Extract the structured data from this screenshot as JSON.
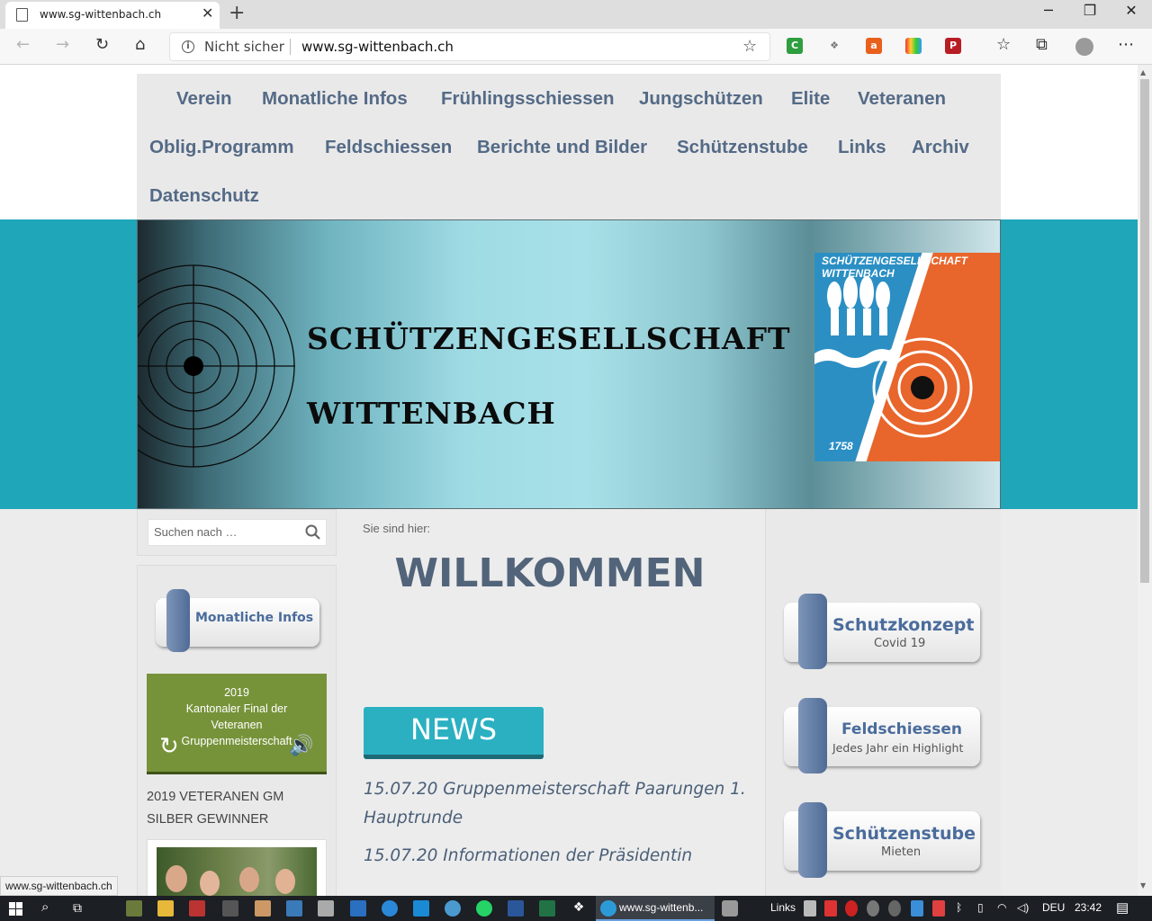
{
  "browser": {
    "tab_title": "www.sg-wittenbach.ch",
    "new_tab": "+",
    "security_label": "Nicht sicher",
    "url": "www.sg-wittenbach.ch",
    "icons": [
      "back-icon",
      "forward-icon",
      "refresh-icon",
      "home-icon",
      "info-icon",
      "favorite-star-icon",
      "favorites-icon",
      "collections-icon",
      "profile-icon",
      "more-icon"
    ]
  },
  "nav": {
    "row1": [
      "Verein",
      "Monatliche Infos",
      "Frühlingsschiessen",
      "Jungschützen",
      "Elite",
      "Veteranen"
    ],
    "row2": [
      "Oblig.Programm",
      "Feldschiessen",
      "Berichte und Bilder",
      "Schützenstube",
      "Links",
      "Archiv"
    ],
    "row3": [
      "Datenschutz"
    ]
  },
  "banner": {
    "line1": "SCHÜTZENGESELLSCHAFT",
    "line2": "WITTENBACH",
    "flag_caption": "SCHÜTZENGESELLSCHAFT WITTENBACH",
    "flag_year": "1758"
  },
  "sidebar": {
    "search_placeholder": "Suchen nach …",
    "monthly_button": "Monatliche Infos",
    "video_text": [
      "2019",
      "Kantonaler Final der",
      "Veteranen",
      "Gruppenmeisterschaft"
    ],
    "veteran_text": [
      "2019 VETERANEN GM",
      "SILBER GEWINNER"
    ]
  },
  "main": {
    "breadcrumb": "Sie sind hier:",
    "title": "WILLKOMMEN",
    "news_label": "NEWS",
    "news_items": [
      "15.07.20 Gruppenmeisterschaft Paarungen 1. Hauptrunde",
      "15.07.20 Informationen der Präsidentin"
    ]
  },
  "right": {
    "buttons": [
      {
        "label": "Schutzkonzept",
        "sub": "Covid 19"
      },
      {
        "label": "Feldschiessen",
        "sub": "Jedes Jahr ein Highlight"
      },
      {
        "label": "Schützenstube",
        "sub": "Mieten"
      }
    ]
  },
  "status_url": "www.sg-wittenbach.ch",
  "taskbar": {
    "active_label": "www.sg-wittenb...",
    "links_label": "Links",
    "lang": "DEU",
    "time": "23:42"
  },
  "colors": {
    "nav_text": "#546a86",
    "teal": "#1fa6b8",
    "news_bg": "#2bb0c2"
  }
}
